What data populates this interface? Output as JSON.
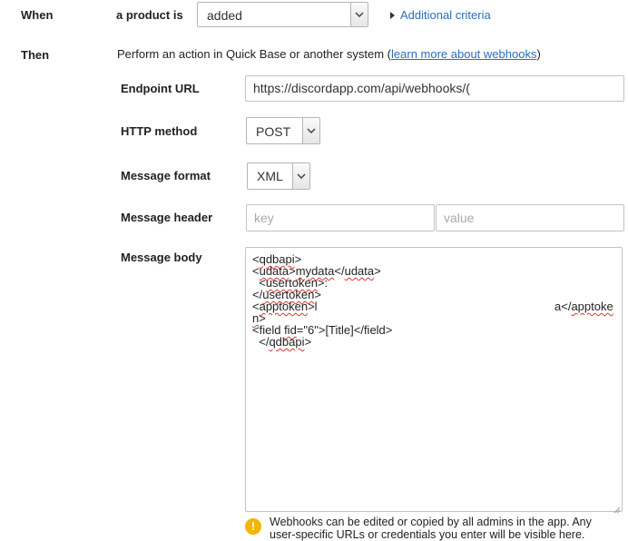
{
  "when": {
    "label": "When",
    "subject_label": "a product is",
    "event_value": "added",
    "additional_criteria_label": "Additional criteria"
  },
  "then": {
    "label": "Then",
    "description_prefix": "Perform an action in Quick Base or another system (",
    "learn_more_link": "learn more about webhooks",
    "description_suffix": ")"
  },
  "endpoint": {
    "label": "Endpoint URL",
    "value": "https://discordapp.com/api/webhooks/("
  },
  "http_method": {
    "label": "HTTP method",
    "value": "POST"
  },
  "message_format": {
    "label": "Message format",
    "value": "XML"
  },
  "message_header": {
    "label": "Message header",
    "key_placeholder": "key",
    "value_placeholder": "value"
  },
  "message_body": {
    "label": "Message body",
    "lines": [
      "<qdbapi>",
      "<udata>mydata</udata>",
      "  <usertoken>:",
      "</usertoken>",
      "<apptoken>l",
      "a</apptoke",
      "n>",
      "<field fid=\"6\">[Title]</field>",
      "</qdbapi>"
    ]
  },
  "warning": {
    "icon": "exclamation-icon",
    "color": "#f5b400",
    "text": "Webhooks can be edited or copied by all admins in the app. Any user-specific URLs or credentials you enter will be visible here."
  }
}
